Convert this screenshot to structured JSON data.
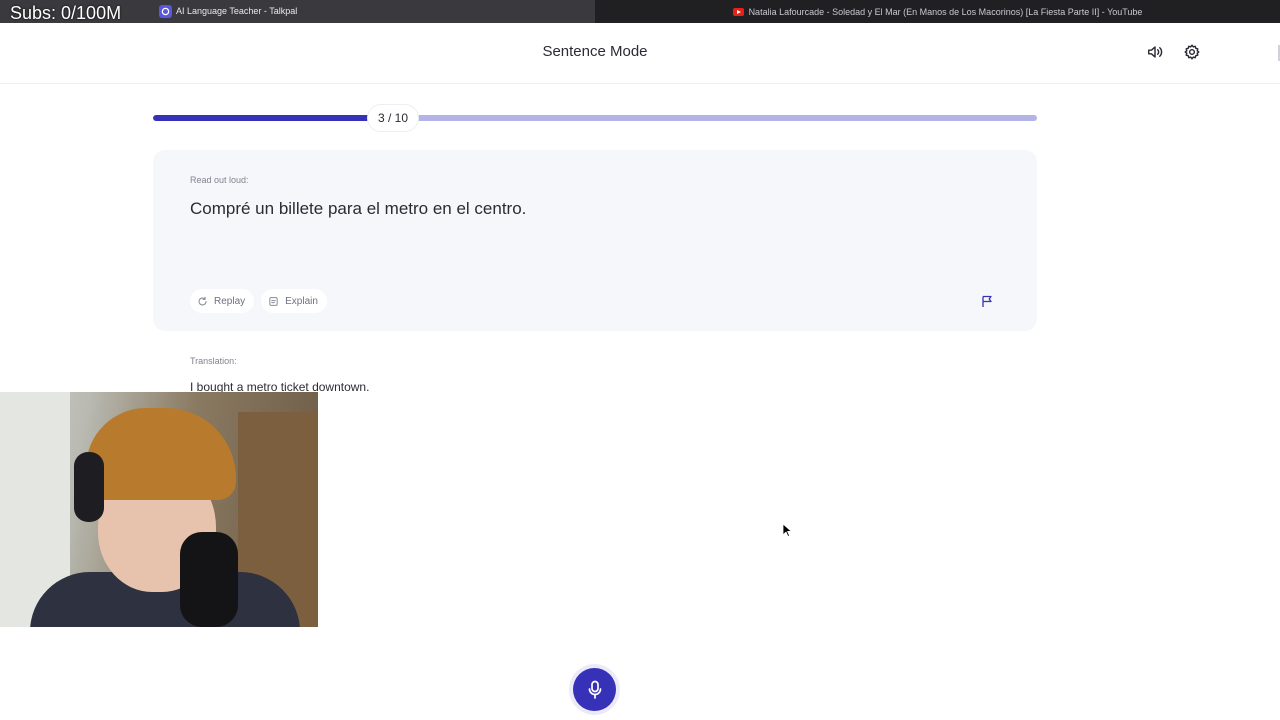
{
  "overlay": {
    "subs_counter": "Subs: 0/100M"
  },
  "browser": {
    "tabs": [
      {
        "title": "AI Language Teacher - Talkpal",
        "icon": "talkpal-icon"
      },
      {
        "title": "Natalia Lafourcade - Soledad y El Mar (En Manos de Los Macorinos) [La Fiesta Parte II] - YouTube",
        "icon": "youtube-icon"
      }
    ]
  },
  "header": {
    "title": "Sentence Mode",
    "icons": [
      "speaker-icon",
      "gear-icon"
    ]
  },
  "progress": {
    "label": "3 / 10",
    "current": 3,
    "total": 10,
    "fraction": 0.3,
    "fill_color": "#3631b6",
    "track_color": "#b4b3e8"
  },
  "card": {
    "instruction": "Read out loud:",
    "sentence": "Compré un billete para el metro en el centro.",
    "actions": [
      {
        "label": "Replay",
        "icon": "replay-icon"
      },
      {
        "label": "Explain",
        "icon": "explain-icon"
      }
    ],
    "flag_icon": "flag-icon"
  },
  "translation": {
    "label": "Translation:",
    "text": "I bought a metro ticket downtown."
  },
  "mic": {
    "icon": "microphone-icon",
    "color": "#3631b6"
  }
}
